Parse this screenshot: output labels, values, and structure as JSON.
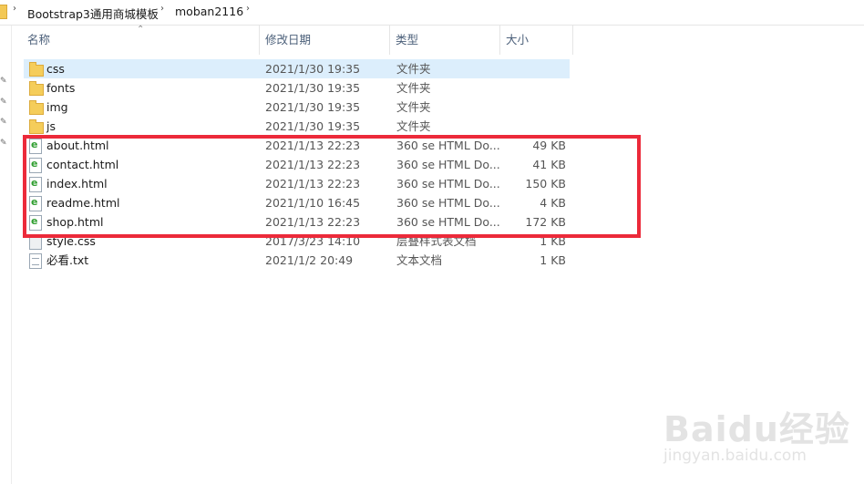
{
  "breadcrumb": {
    "items": [
      "Bootstrap3通用商城模板",
      "moban2116"
    ],
    "separator": "›"
  },
  "columns": {
    "name": "名称",
    "date": "修改日期",
    "type": "类型",
    "size": "大小"
  },
  "files": [
    {
      "name": "css",
      "date": "2021/1/30 19:35",
      "type": "文件夹",
      "size": "",
      "icon": "folder-icon"
    },
    {
      "name": "fonts",
      "date": "2021/1/30 19:35",
      "type": "文件夹",
      "size": "",
      "icon": "folder-icon"
    },
    {
      "name": "img",
      "date": "2021/1/30 19:35",
      "type": "文件夹",
      "size": "",
      "icon": "folder-icon"
    },
    {
      "name": "js",
      "date": "2021/1/30 19:35",
      "type": "文件夹",
      "size": "",
      "icon": "folder-icon"
    },
    {
      "name": "about.html",
      "date": "2021/1/13 22:23",
      "type": "360 se HTML Do...",
      "size": "49 KB",
      "icon": "html-file-icon"
    },
    {
      "name": "contact.html",
      "date": "2021/1/13 22:23",
      "type": "360 se HTML Do...",
      "size": "41 KB",
      "icon": "html-file-icon"
    },
    {
      "name": "index.html",
      "date": "2021/1/13 22:23",
      "type": "360 se HTML Do...",
      "size": "150 KB",
      "icon": "html-file-icon"
    },
    {
      "name": "readme.html",
      "date": "2021/1/10 16:45",
      "type": "360 se HTML Do...",
      "size": "4 KB",
      "icon": "html-file-icon"
    },
    {
      "name": "shop.html",
      "date": "2021/1/13 22:23",
      "type": "360 se HTML Do...",
      "size": "172 KB",
      "icon": "html-file-icon"
    },
    {
      "name": "style.css",
      "date": "2017/3/23 14:10",
      "type": "层叠样式表文档",
      "size": "1 KB",
      "icon": "css-file-icon"
    },
    {
      "name": "必看.txt",
      "date": "2021/1/2 20:49",
      "type": "文本文档",
      "size": "1 KB",
      "icon": "text-file-icon"
    }
  ],
  "watermark": {
    "logo": "Baidu经验",
    "url": "jingyan.baidu.com"
  },
  "colors": {
    "selection": "#dceefc",
    "annotation": "#ec2a3a",
    "header_text": "#4c607a"
  }
}
